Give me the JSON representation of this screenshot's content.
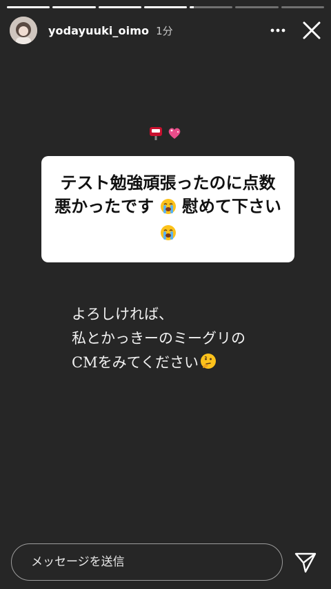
{
  "story": {
    "progress": [
      1,
      1,
      1,
      1,
      0.1,
      0,
      0
    ],
    "username": "yodayuuki_oimo",
    "time": "1分"
  },
  "question": {
    "text_parts": [
      "テスト勉強頑張ったのに点数",
      "悪かったです",
      "慰めて下さい"
    ]
  },
  "answer": {
    "lines": [
      "よろしければ、",
      "私とかっきーのミーグリの",
      "CMをみてください"
    ]
  },
  "message_bar": {
    "placeholder": "メッセージを送信"
  },
  "icons": {
    "sticker_left": "mailbox-icon",
    "sticker_right": "heart-icon",
    "crying": "crying-face-icon",
    "thinking": "thinking-face-icon"
  }
}
